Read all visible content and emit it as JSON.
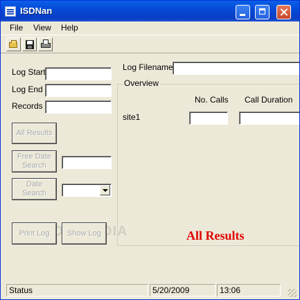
{
  "window": {
    "title": "ISDNan"
  },
  "menu": {
    "file": "File",
    "view": "View",
    "help": "Help"
  },
  "toolbar": {
    "open_icon": "open-folder-icon",
    "save_icon": "floppy-disk-icon",
    "print_icon": "printer-icon"
  },
  "left": {
    "log_start_label": "Log Start",
    "log_start_value": "",
    "log_end_label": "Log End",
    "log_end_value": "",
    "records_label": "Records",
    "records_value": "",
    "all_results_button": "All Results",
    "free_date_search_button": "Free Date Search",
    "free_date_value": "",
    "date_search_button": "Date Search",
    "date_select_value": "",
    "print_log_button": "Print Log",
    "show_log_button": "Show Log"
  },
  "right": {
    "log_filename_label": "Log Filename",
    "log_filename_value": "",
    "overview_title": "Overview",
    "col_calls": "No. Calls",
    "col_duration": "Call Duration",
    "row_site": "site1",
    "site1_calls": "",
    "site1_duration": "",
    "mode_text": "All Results"
  },
  "watermark": "SOFTPEDIA",
  "status": {
    "status": "Status",
    "date": "5/20/2009",
    "time": "13:06"
  }
}
